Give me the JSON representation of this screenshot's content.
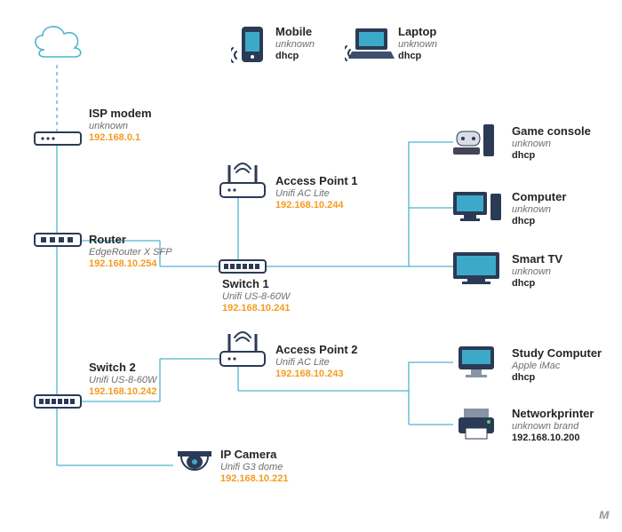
{
  "colors": {
    "accent": "#f59b1f",
    "wire": "#4fb3cf",
    "text": "#252525"
  },
  "nodes": {
    "mobile": {
      "name": "Mobile",
      "model": "unknown",
      "ip": "dhcp"
    },
    "laptop": {
      "name": "Laptop",
      "model": "unknown",
      "ip": "dhcp"
    },
    "ispmodem": {
      "name": "ISP modem",
      "model": "unknown",
      "ip": "192.168.0.1"
    },
    "router": {
      "name": "Router",
      "model": "EdgeRouter X SFP",
      "ip": "192.168.10.254"
    },
    "ap1": {
      "name": "Access Point 1",
      "model": "Unifi AC Lite",
      "ip": "192.168.10.244"
    },
    "ap2": {
      "name": "Access Point 2",
      "model": "Unifi AC Lite",
      "ip": "192.168.10.243"
    },
    "switch1": {
      "name": "Switch 1",
      "model": "Unifi US-8-60W",
      "ip": "192.168.10.241"
    },
    "switch2": {
      "name": "Switch 2",
      "model": "Unifi US-8-60W",
      "ip": "192.168.10.242"
    },
    "ipcamera": {
      "name": "IP Camera",
      "model": "Unifi G3 dome",
      "ip": "192.168.10.221"
    },
    "gconsole": {
      "name": "Game console",
      "model": "unknown",
      "ip": "dhcp"
    },
    "computer": {
      "name": "Computer",
      "model": "unknown",
      "ip": "dhcp"
    },
    "smarttv": {
      "name": "Smart TV",
      "model": "unknown",
      "ip": "dhcp"
    },
    "study": {
      "name": "Study Computer",
      "model": "Apple iMac",
      "ip": "dhcp"
    },
    "printer": {
      "name": "Networkprinter",
      "model": "unknown brand",
      "ip": "192.168.10.200"
    }
  },
  "cloud": {
    "name": "internet-cloud"
  },
  "watermark": "ᴍ"
}
